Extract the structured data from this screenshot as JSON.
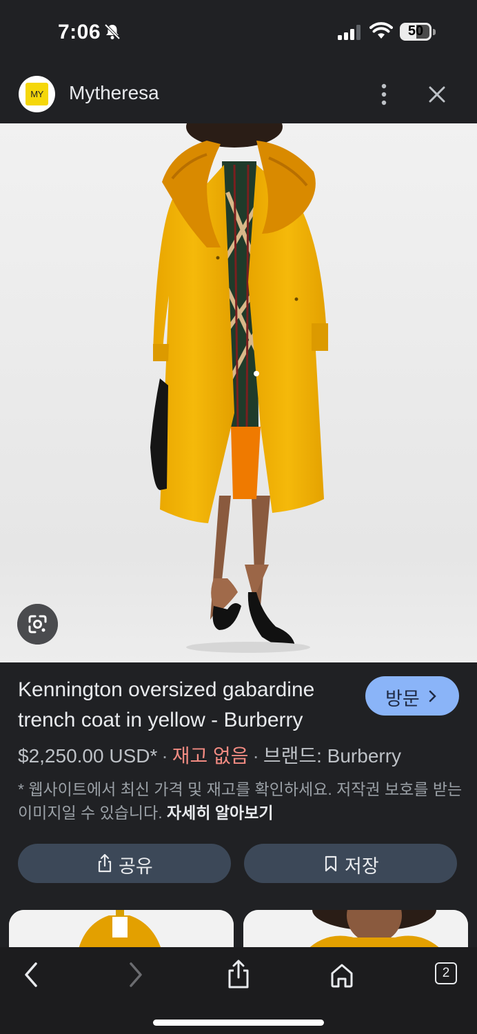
{
  "status_bar": {
    "time": "7:06",
    "battery": "50",
    "icons": [
      "bell-slash-icon",
      "cellular-signal-icon",
      "wifi-icon",
      "battery-icon"
    ]
  },
  "header": {
    "logo_text": "MY",
    "site_name": "Mytheresa",
    "icons": [
      "more-vertical-icon",
      "close-icon"
    ]
  },
  "product": {
    "title": "Kennington oversized gabardine trench coat in yellow - Burberry",
    "price": "$2,250.00 USD*",
    "separator": "·",
    "stock": "재고 없음",
    "brand": "브랜드: Burberry",
    "disclaimer": "* 웹사이트에서 최신 가격 및 재고를 확인하세요. 저작권 보호를 받는 이미지일 수 있습니다.",
    "learn_more": "자세히 알아보기",
    "visit_label": "방문"
  },
  "actions": {
    "share_label": "공유",
    "save_label": "저장"
  },
  "toolbar": {
    "tab_count": "2",
    "icons": [
      "back-icon",
      "forward-icon",
      "share-icon",
      "home-icon",
      "tabs-icon"
    ]
  },
  "colors": {
    "background": "#202124",
    "accent": "#8ab4f8",
    "out_of_stock": "#f28b82",
    "coat": "#f2b705"
  }
}
